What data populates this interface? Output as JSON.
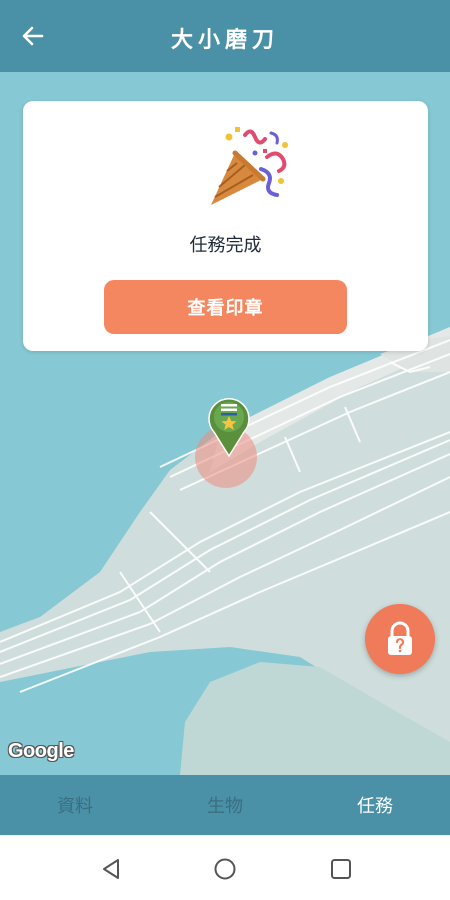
{
  "header": {
    "title": "大小磨刀",
    "back_icon": "arrow-left-icon",
    "background": "#4a90a6"
  },
  "task_card": {
    "icon": "party-popper-icon",
    "message": "任務完成",
    "button_label": "查看印章",
    "button_color": "#f58760"
  },
  "map": {
    "attribution": "Google",
    "marker_icon": "star-pin-icon",
    "fab_icon": "lock-question-icon",
    "water_color": "#86c9d4",
    "land_color": "#cfdedc"
  },
  "bottom_nav": {
    "tabs": [
      {
        "label": "資料",
        "active": false
      },
      {
        "label": "生物",
        "active": false
      },
      {
        "label": "任務",
        "active": true
      }
    ]
  },
  "system_nav": {
    "back_icon": "triangle-back-icon",
    "home_icon": "circle-home-icon",
    "recents_icon": "square-recents-icon"
  }
}
